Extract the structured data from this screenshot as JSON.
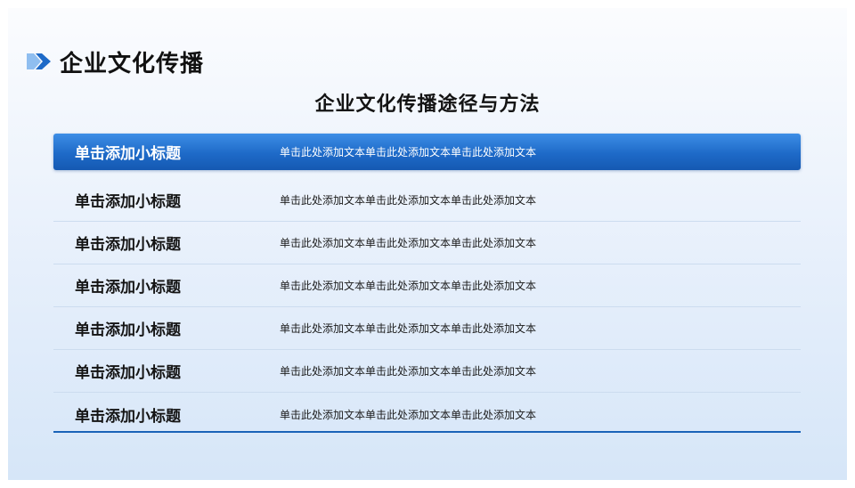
{
  "header": {
    "title": "企业文化传播",
    "icon": "chevron-double-right-icon"
  },
  "main": {
    "title": "企业文化传播途径与方法"
  },
  "table": {
    "rows": [
      {
        "title": "单击添加小标题",
        "text": "单击此处添加文本单击此处添加文本单击此处添加文本"
      },
      {
        "title": "单击添加小标题",
        "text": "单击此处添加文本单击此处添加文本单击此处添加文本"
      },
      {
        "title": "单击添加小标题",
        "text": "单击此处添加文本单击此处添加文本单击此处添加文本"
      },
      {
        "title": "单击添加小标题",
        "text": "单击此处添加文本单击此处添加文本单击此处添加文本"
      },
      {
        "title": "单击添加小标题",
        "text": "单击此处添加文本单击此处添加文本单击此处添加文本"
      },
      {
        "title": "单击添加小标题",
        "text": "单击此处添加文本单击此处添加文本单击此处添加文本"
      },
      {
        "title": "单击添加小标题",
        "text": "单击此处添加文本单击此处添加文本单击此处添加文本"
      }
    ]
  },
  "colors": {
    "accent": "#1e6ac8",
    "accent_light": "#3d8ee6",
    "background_top": "#fbfcfe",
    "background_bottom": "#d6e6f8",
    "row_divider": "#ccdcef"
  }
}
